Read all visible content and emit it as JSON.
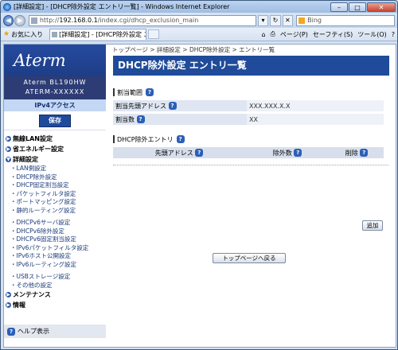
{
  "window": {
    "title": "[詳細設定] - [DHCP除外設定 エントリ一覧] - Windows Internet Explorer",
    "min": "–",
    "max": "□",
    "close": "✕"
  },
  "address": {
    "url_prefix": "http://",
    "url_host": "192.168.0.1",
    "url_path": "/index.cgi/dhcp_exclusion_main",
    "search_placeholder": "Bing"
  },
  "favorites": {
    "label": "お気に入り",
    "tab_title": "[詳細設定] - [DHCP除外設定 エント...",
    "commands": [
      "ページ(P)",
      "セーフティ(S)",
      "ツール(O)"
    ]
  },
  "sidebar": {
    "logo": "Aterm",
    "model_line1": "Aterm BL190HW",
    "model_line2": "ATERM-XXXXXX",
    "mode": "IPv4アクセス",
    "save_label": "保存",
    "sections": [
      {
        "label": "無線LAN設定",
        "items": []
      },
      {
        "label": "省エネルギー設定",
        "items": []
      },
      {
        "label": "詳細設定",
        "items": [
          "LAN側設定",
          "DHCP除外設定",
          "DHCP固定割当設定",
          "パケットフィルタ設定",
          "ポートマッピング設定",
          "静的ルーティング設定"
        ]
      }
    ],
    "ipv6_items": [
      "DHCPv6サーバ設定",
      "DHCPv6除外設定",
      "DHCPv6固定割当設定",
      "IPv6パケットフィルタ設定",
      "IPv6ホスト公開設定",
      "IPv6ルーティング設定"
    ],
    "other_items": [
      "USBストレージ設定",
      "その他の設定"
    ],
    "bottom_sections": [
      "メンテナンス",
      "情報"
    ],
    "help": "ヘルプ表示"
  },
  "main": {
    "breadcrumb": "トップページ > 詳細設定 > DHCP除外設定 > エントリ一覧",
    "title": "DHCP除外設定 エントリ一覧",
    "range_section": "割当範囲",
    "range_rows": [
      {
        "label": "割当先頭アドレス",
        "value": "XXX.XXX.X.X"
      },
      {
        "label": "割当数",
        "value": "XX"
      }
    ],
    "entry_section": "DHCP除外エントリ",
    "entry_headers": [
      "先頭アドレス",
      "除外数",
      "削除"
    ],
    "add_label": "追加",
    "back_label": "トップページへ戻る",
    "help_glyph": "?"
  }
}
